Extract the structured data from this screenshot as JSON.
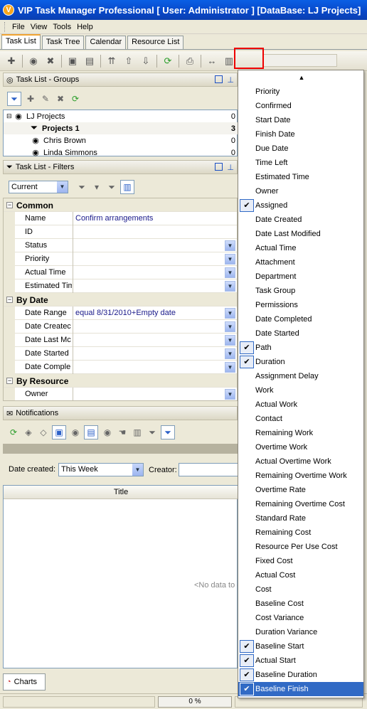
{
  "window": {
    "title": "VIP Task Manager Professional [ User: Administrator ] [DataBase: LJ Projects]"
  },
  "menu": [
    "File",
    "View",
    "Tools",
    "Help"
  ],
  "tabs": [
    "Task List",
    "Task Tree",
    "Calendar",
    "Resource List"
  ],
  "groups_panel": {
    "title": "Task List - Groups",
    "items": [
      {
        "label": "LJ Projects",
        "count": "0"
      },
      {
        "label": "Projects 1",
        "count": "3"
      },
      {
        "label": "Chris Brown",
        "count": "0"
      },
      {
        "label": "Linda Simmons",
        "count": "0"
      }
    ]
  },
  "filters_panel": {
    "title": "Task List - Filters",
    "view": "Current",
    "categories": [
      {
        "label": "Common",
        "rows": [
          {
            "name": "Name",
            "value": "Confirm arrangements",
            "dropdown": false
          },
          {
            "name": "ID",
            "value": "",
            "dropdown": false
          },
          {
            "name": "Status",
            "value": "",
            "dropdown": true
          },
          {
            "name": "Priority",
            "value": "",
            "dropdown": true
          },
          {
            "name": "Actual Time",
            "value": "",
            "dropdown": true
          },
          {
            "name": "Estimated Tim",
            "value": "",
            "dropdown": true
          }
        ]
      },
      {
        "label": "By Date",
        "rows": [
          {
            "name": "Date Range",
            "value": "equal 8/31/2010+Empty date",
            "dropdown": true
          },
          {
            "name": "Date Createc",
            "value": "",
            "dropdown": true
          },
          {
            "name": "Date Last Mc",
            "value": "",
            "dropdown": true
          },
          {
            "name": "Date Started",
            "value": "",
            "dropdown": true
          },
          {
            "name": "Date Comple",
            "value": "",
            "dropdown": true
          }
        ]
      },
      {
        "label": "By Resource",
        "rows": [
          {
            "name": "Owner",
            "value": "",
            "dropdown": true
          }
        ]
      }
    ]
  },
  "notifications": {
    "title": "Notifications",
    "date_created_label": "Date created:",
    "date_created_value": "This Week",
    "creator_label": "Creator:",
    "column_title": "Title",
    "empty_text": "<No data to c"
  },
  "bottom_tab": "Charts",
  "status": {
    "progress": "0 %"
  },
  "column_menu": {
    "items": [
      {
        "label": "Priority",
        "checked": false
      },
      {
        "label": "Confirmed",
        "checked": false
      },
      {
        "label": "Start Date",
        "checked": false
      },
      {
        "label": "Finish Date",
        "checked": false
      },
      {
        "label": "Due Date",
        "checked": false
      },
      {
        "label": "Time Left",
        "checked": false
      },
      {
        "label": "Estimated Time",
        "checked": false
      },
      {
        "label": "Owner",
        "checked": false
      },
      {
        "label": "Assigned",
        "checked": true
      },
      {
        "label": "Date Created",
        "checked": false
      },
      {
        "label": "Date Last Modified",
        "checked": false
      },
      {
        "label": "Actual Time",
        "checked": false
      },
      {
        "label": "Attachment",
        "checked": false
      },
      {
        "label": "Department",
        "checked": false
      },
      {
        "label": "Task Group",
        "checked": false
      },
      {
        "label": "Permissions",
        "checked": false
      },
      {
        "label": "Date Completed",
        "checked": false
      },
      {
        "label": "Date Started",
        "checked": false
      },
      {
        "label": "Path",
        "checked": true
      },
      {
        "label": "Duration",
        "checked": true
      },
      {
        "label": "Assignment Delay",
        "checked": false
      },
      {
        "label": "Work",
        "checked": false
      },
      {
        "label": "Actual Work",
        "checked": false
      },
      {
        "label": "Contact",
        "checked": false
      },
      {
        "label": "Remaining Work",
        "checked": false
      },
      {
        "label": "Overtime Work",
        "checked": false
      },
      {
        "label": "Actual Overtime Work",
        "checked": false
      },
      {
        "label": "Remaining Overtime Work",
        "checked": false
      },
      {
        "label": "Overtime Rate",
        "checked": false
      },
      {
        "label": "Remaining Overtime Cost",
        "checked": false
      },
      {
        "label": "Standard Rate",
        "checked": false
      },
      {
        "label": "Remaining Cost",
        "checked": false
      },
      {
        "label": "Resource Per Use Cost",
        "checked": false
      },
      {
        "label": "Fixed Cost",
        "checked": false
      },
      {
        "label": "Actual Cost",
        "checked": false
      },
      {
        "label": "Cost",
        "checked": false
      },
      {
        "label": "Baseline Cost",
        "checked": false
      },
      {
        "label": "Cost Variance",
        "checked": false
      },
      {
        "label": "Duration Variance",
        "checked": false
      },
      {
        "label": "Baseline Start",
        "checked": true
      },
      {
        "label": "Actual Start",
        "checked": true
      },
      {
        "label": "Baseline Duration",
        "checked": true
      },
      {
        "label": "Baseline Finish",
        "checked": true,
        "selected": true
      }
    ]
  },
  "colors": {
    "title_bar": "#0a5fe5",
    "selection": "#316ac5",
    "highlight_box": "#e00000"
  }
}
